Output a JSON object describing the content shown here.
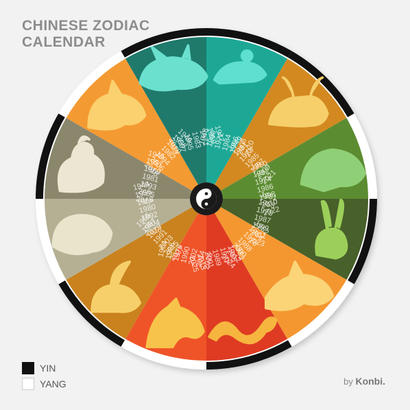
{
  "title": {
    "line1": "CHINESE ZODIAC",
    "line2": "CALENDAR"
  },
  "legend": [
    {
      "label": "YIN",
      "color": "#111111"
    },
    {
      "label": "YANG",
      "color": "#ffffff"
    }
  ],
  "credit": {
    "by": "by",
    "brand": "Konbi."
  },
  "center_icon": "yin-yang-icon",
  "segments": [
    {
      "animal": "rat",
      "icon": "rat-icon",
      "color": "#1da896",
      "figure": "#5fdfcf",
      "rim": "yin",
      "years": [
        "1948",
        "1960",
        "1972",
        "1984",
        "1996",
        "2008",
        "2020"
      ]
    },
    {
      "animal": "ox",
      "icon": "ox-icon",
      "color": "#d38920",
      "figure": "#f6cf6a",
      "rim": "yin",
      "years": [
        "1949",
        "1961",
        "1973",
        "1985",
        "1997",
        "2009",
        "2021"
      ]
    },
    {
      "animal": "tiger",
      "icon": "tiger-icon",
      "color": "#5c8c31",
      "figure": "#8fcf77",
      "rim": "yang",
      "years": [
        "1950",
        "1962",
        "1974",
        "1986",
        "1998",
        "2010",
        "2022"
      ]
    },
    {
      "animal": "rabbit",
      "icon": "rabbit-icon",
      "color": "#48602a",
      "figure": "#9ccf5a",
      "rim": "yin",
      "years": [
        "1951",
        "1963",
        "1975",
        "1987",
        "1999",
        "2011",
        "2023"
      ]
    },
    {
      "animal": "dragon",
      "icon": "dragon-icon",
      "color": "#f49730",
      "figure": "#fbd478",
      "rim": "yang",
      "years": [
        "1952",
        "1964",
        "1976",
        "1988",
        "2000",
        "2012",
        "2024"
      ]
    },
    {
      "animal": "snake",
      "icon": "snake-icon",
      "color": "#df3b23",
      "figure": "#f6b53f",
      "rim": "yin",
      "years": [
        "1953",
        "1965",
        "1977",
        "1989",
        "2001",
        "2013",
        "2025"
      ]
    },
    {
      "animal": "horse",
      "icon": "horse-icon",
      "color": "#ef5428",
      "figure": "#f8c34a",
      "rim": "yang",
      "years": [
        "1954",
        "1966",
        "1978",
        "1990",
        "2002",
        "2014",
        "2026"
      ]
    },
    {
      "animal": "goat",
      "icon": "goat-icon",
      "color": "#c9821e",
      "figure": "#f6cf6a",
      "rim": "yin",
      "years": [
        "1955",
        "1967",
        "1979",
        "1991",
        "2003",
        "2015",
        "2027"
      ]
    },
    {
      "animal": "monkey",
      "icon": "monkey-icon",
      "color": "#b5b094",
      "figure": "#e9e4cc",
      "rim": "yang",
      "years": [
        "1944",
        "1956",
        "1968",
        "1980",
        "1992",
        "2004",
        "2016"
      ]
    },
    {
      "animal": "rooster",
      "icon": "rooster-icon",
      "color": "#8b876d",
      "figure": "#ebe7d2",
      "rim": "yin",
      "years": [
        "1945",
        "1957",
        "1969",
        "1981",
        "1993",
        "2005",
        "2017"
      ]
    },
    {
      "animal": "dog",
      "icon": "dog-icon",
      "color": "#f49a32",
      "figure": "#fbd06e",
      "rim": "yang",
      "years": [
        "1946",
        "1958",
        "1970",
        "1982",
        "1994",
        "2006",
        "2018"
      ]
    },
    {
      "animal": "pig",
      "icon": "pig-icon",
      "color": "#1f7a6c",
      "figure": "#6be0cf",
      "rim": "yin",
      "years": [
        "1947",
        "1959",
        "1971",
        "1983",
        "1995",
        "2007",
        "2019"
      ]
    }
  ]
}
